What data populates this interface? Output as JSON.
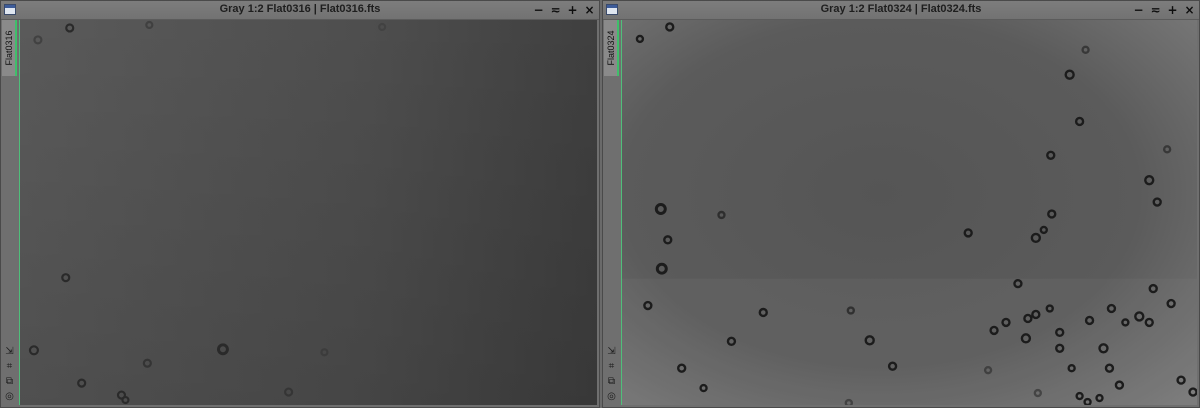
{
  "windows": [
    {
      "title": "Gray 1:2 Flat0316 | Flat0316.fts",
      "side_tab": "Flat0316",
      "controls": [
        "minimize-icon",
        "shade-icon",
        "maximize-icon",
        "close-icon"
      ],
      "tools": [
        "fit-icon",
        "zoom-icon",
        "clone-icon",
        "target-icon"
      ]
    },
    {
      "title": "Gray 1:2 Flat0324 | Flat0324.fts",
      "side_tab": "Flat0324",
      "controls": [
        "minimize-icon",
        "shade-icon",
        "maximize-icon",
        "close-icon"
      ],
      "tools": [
        "fit-icon",
        "zoom-icon",
        "clone-icon",
        "target-icon"
      ]
    }
  ],
  "glyphs": {
    "minimize": "−",
    "shade": "≂",
    "maximize": "+",
    "close": "×",
    "fit": "⇲",
    "zoom": "⌗",
    "clone": "⧉",
    "target": "◎"
  }
}
